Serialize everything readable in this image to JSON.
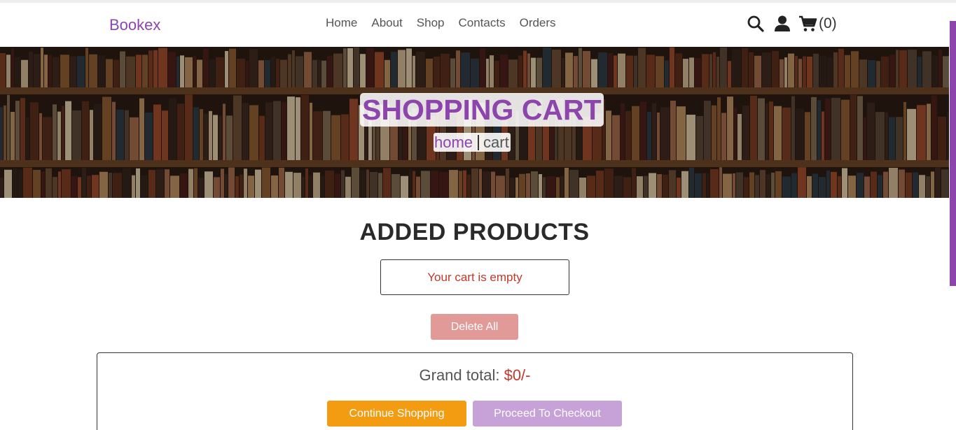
{
  "header": {
    "logo": "Bookex",
    "nav": [
      "Home",
      "About",
      "Shop",
      "Contacts",
      "Orders"
    ],
    "icons": [
      "search-icon",
      "user-icon",
      "cart-icon"
    ],
    "cart_count": "(0)"
  },
  "hero": {
    "title": "SHOPPING CART",
    "breadcrumb_home": "home",
    "breadcrumb_current": "cart"
  },
  "cart": {
    "section_title": "ADDED PRODUCTS",
    "empty_message": "Your cart is empty",
    "delete_all_label": "Delete All",
    "grand_total_label": "Grand total:",
    "grand_total_value": "$0/-",
    "continue_label": "Continue Shopping",
    "checkout_label": "Proceed To Checkout"
  },
  "colors": {
    "brand": "#8e44ad",
    "price": "#c0392b",
    "continue": "#f39c12",
    "checkout_disabled": "#c7a2d9",
    "delete_disabled": "#e29a98"
  }
}
